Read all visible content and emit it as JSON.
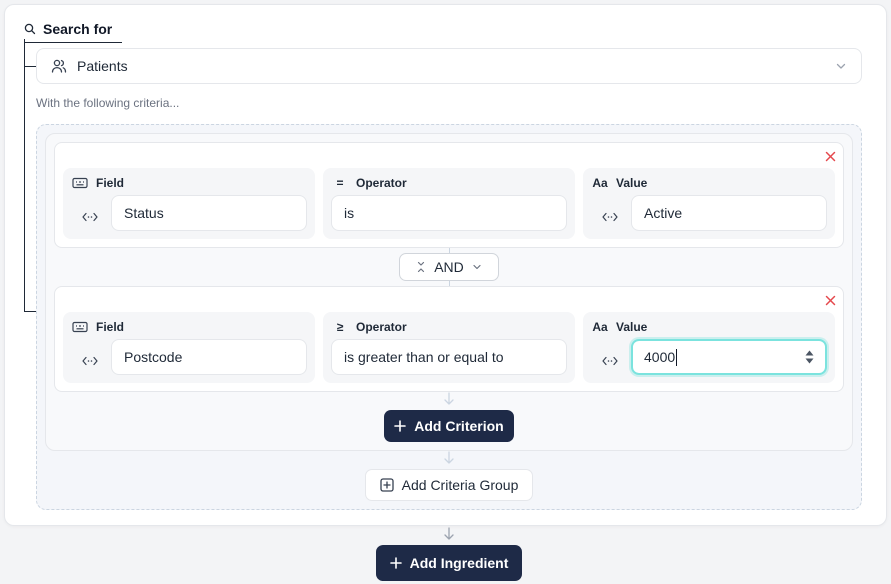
{
  "search": {
    "label": "Search for",
    "entity": "Patients",
    "criteria_intro": "With the following criteria..."
  },
  "criteria": [
    {
      "field_label": "Field",
      "field_value": "Status",
      "operator_label": "Operator",
      "operator_symbol": "=",
      "operator_value": "is",
      "value_label": "Value",
      "value_symbol": "Aa",
      "value_value": "Active"
    },
    {
      "field_label": "Field",
      "field_value": "Postcode",
      "operator_label": "Operator",
      "operator_symbol": "≥",
      "operator_value": "is greater than or equal to",
      "value_label": "Value",
      "value_symbol": "Aa",
      "value_value": "4000"
    }
  ],
  "connector": {
    "label": "AND"
  },
  "buttons": {
    "add_criterion": "Add Criterion",
    "add_criteria_group": "Add Criteria Group",
    "add_ingredient": "Add Ingredient"
  },
  "colors": {
    "primary_dark": "#1e2a47",
    "focus_ring": "#7be3de",
    "remove_red": "#e5484d"
  }
}
